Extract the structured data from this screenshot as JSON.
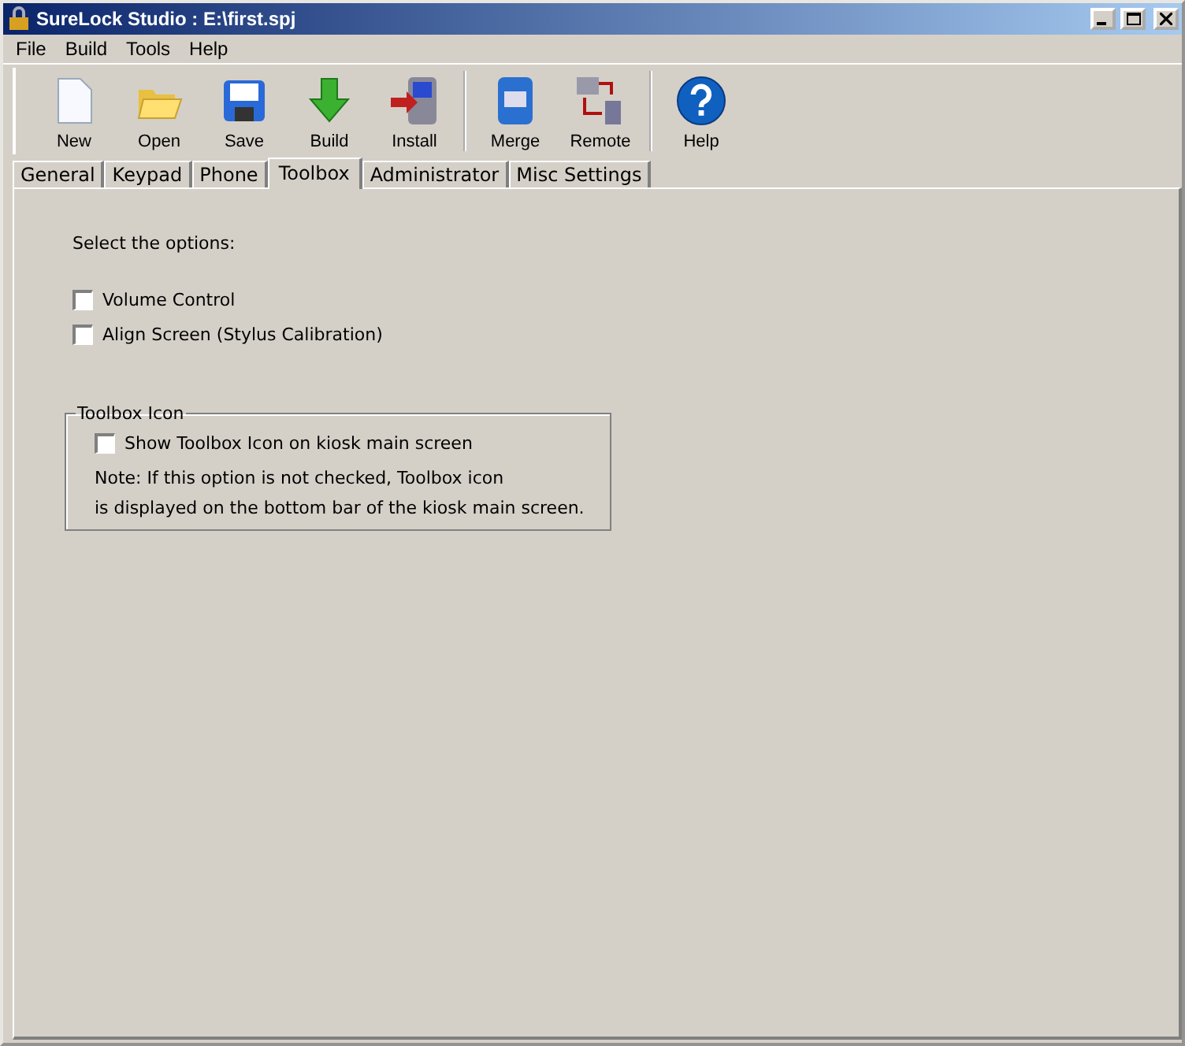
{
  "window": {
    "title": "SureLock Studio : E:\\first.spj"
  },
  "menu": [
    "File",
    "Build",
    "Tools",
    "Help"
  ],
  "toolbar": {
    "groups": [
      [
        {
          "label": "New",
          "kind": "new"
        },
        {
          "label": "Open",
          "kind": "open"
        },
        {
          "label": "Save",
          "kind": "save"
        },
        {
          "label": "Build",
          "kind": "build"
        },
        {
          "label": "Install",
          "kind": "install"
        }
      ],
      [
        {
          "label": "Merge",
          "kind": "merge"
        },
        {
          "label": "Remote",
          "kind": "remote"
        }
      ],
      [
        {
          "label": "Help",
          "kind": "help"
        }
      ]
    ]
  },
  "tabs": [
    {
      "label": "General",
      "selected": false
    },
    {
      "label": "Keypad",
      "selected": false
    },
    {
      "label": "Phone",
      "selected": false
    },
    {
      "label": "Toolbox",
      "selected": true
    },
    {
      "label": "Administrator",
      "selected": false
    },
    {
      "label": "Misc Settings",
      "selected": false
    }
  ],
  "panel": {
    "prompt": "Select the options:",
    "options": [
      {
        "label": "Volume Control",
        "checked": false
      },
      {
        "label": "Align Screen (Stylus Calibration)",
        "checked": false
      }
    ],
    "group": {
      "title": "Toolbox Icon",
      "option": {
        "label": "Show Toolbox Icon on kiosk main screen",
        "checked": false
      },
      "note": [
        "Note: If this option is not checked, Toolbox icon",
        "is displayed on the bottom bar of the kiosk main screen."
      ]
    }
  }
}
